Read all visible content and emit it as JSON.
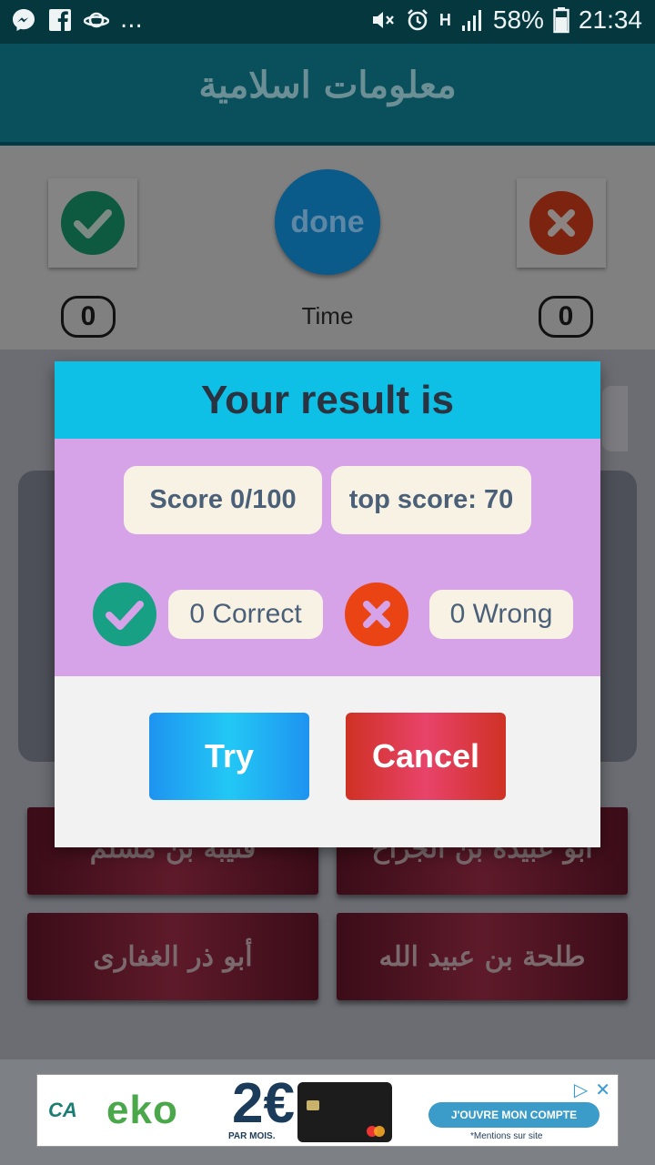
{
  "status_bar": {
    "left_icons": [
      "messenger-icon",
      "facebook-icon",
      "saturn-icon"
    ],
    "overflow": "...",
    "network": "H",
    "battery": "58%",
    "time": "21:34"
  },
  "app_bar": {
    "title": "معلومات اسلامية"
  },
  "top_panel": {
    "done_label": "done",
    "correct_count": "0",
    "wrong_count": "0",
    "time_label": "Time"
  },
  "answers": [
    {
      "label": "قتيبة بن مسلم"
    },
    {
      "label": "أبو عبيدة بن الجراح"
    },
    {
      "label": "أبو ذر الغفارى"
    },
    {
      "label": "طلحة بن عبيد الله"
    }
  ],
  "dialog": {
    "title": "Your result is",
    "score": "Score 0/100",
    "top_score": "top score: 70",
    "correct": "0 Correct",
    "wrong": "0 Wrong",
    "try_label": "Try",
    "cancel_label": "Cancel"
  },
  "ad": {
    "brand": "CA",
    "product": "eko",
    "price": "2€",
    "price_sub": "PAR MOIS.",
    "cta": "J'OUVRE MON COMPTE",
    "mention": "*Mentions sur site"
  },
  "colors": {
    "status_bar": "#05373f",
    "app_bar": "#0a4f5c",
    "dialog_header": "#0ebfe6",
    "dialog_body": "#d6a3e8",
    "correct": "#17a083",
    "wrong": "#ea4414",
    "try_button": "#22c8f5",
    "cancel_button": "#cf3124"
  }
}
